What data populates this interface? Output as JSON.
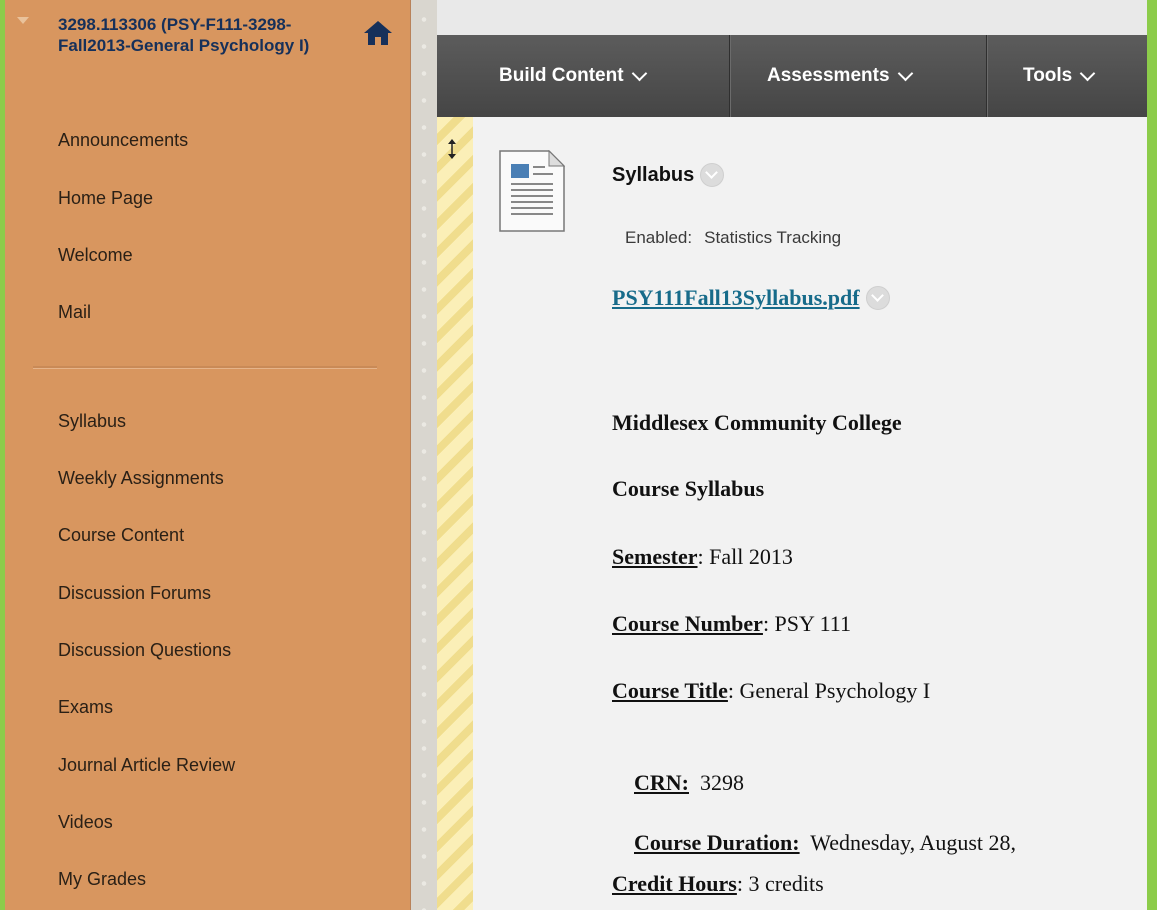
{
  "course": {
    "title": "3298.113306 (PSY-F111-3298-Fall2013-General Psychology I)"
  },
  "sidebar": {
    "items": [
      {
        "label": "Announcements"
      },
      {
        "label": "Home Page"
      },
      {
        "label": "Welcome"
      },
      {
        "label": "Mail"
      },
      {
        "label": "Syllabus"
      },
      {
        "label": "Weekly Assignments"
      },
      {
        "label": "Course Content"
      },
      {
        "label": "Discussion Forums"
      },
      {
        "label": "Discussion Questions"
      },
      {
        "label": "Exams"
      },
      {
        "label": "Journal Article Review"
      },
      {
        "label": "Videos"
      },
      {
        "label": "My Grades"
      }
    ]
  },
  "toolbar": {
    "build_content": "Build Content",
    "assessments": "Assessments",
    "tools": "Tools"
  },
  "item": {
    "title": "Syllabus",
    "enabled_label": "Enabled:",
    "enabled_value": "Statistics Tracking",
    "file_name": "PSY111Fall13Syllabus.pdf"
  },
  "syllabus": {
    "college": "Middlesex Community College",
    "heading": "Course Syllabus",
    "semester_label": "Semester",
    "semester_value": ": Fall 2013",
    "number_label": "Course Number",
    "number_value": ": PSY 111",
    "title_label": "Course Title",
    "title_value": ": General Psychology I",
    "crn_label": "CRN:",
    "crn_value": "  3298",
    "duration_label": "Course Duration:",
    "duration_value": "  Wednesday, August 28, ",
    "credit_label": "Credit Hours",
    "credit_value": ": 3 credits"
  },
  "colors": {
    "sidebar_bg": "#d8965f",
    "course_title": "#16305a",
    "toolbar_bg": "#4f4f4f",
    "link": "#176b8a",
    "backdrop": "#8ccc4a"
  },
  "icons": [
    "collapse-arrow-icon",
    "home-icon",
    "chevron-down-icon",
    "drag-handle-icon",
    "document-icon",
    "options-chevron-icon"
  ]
}
